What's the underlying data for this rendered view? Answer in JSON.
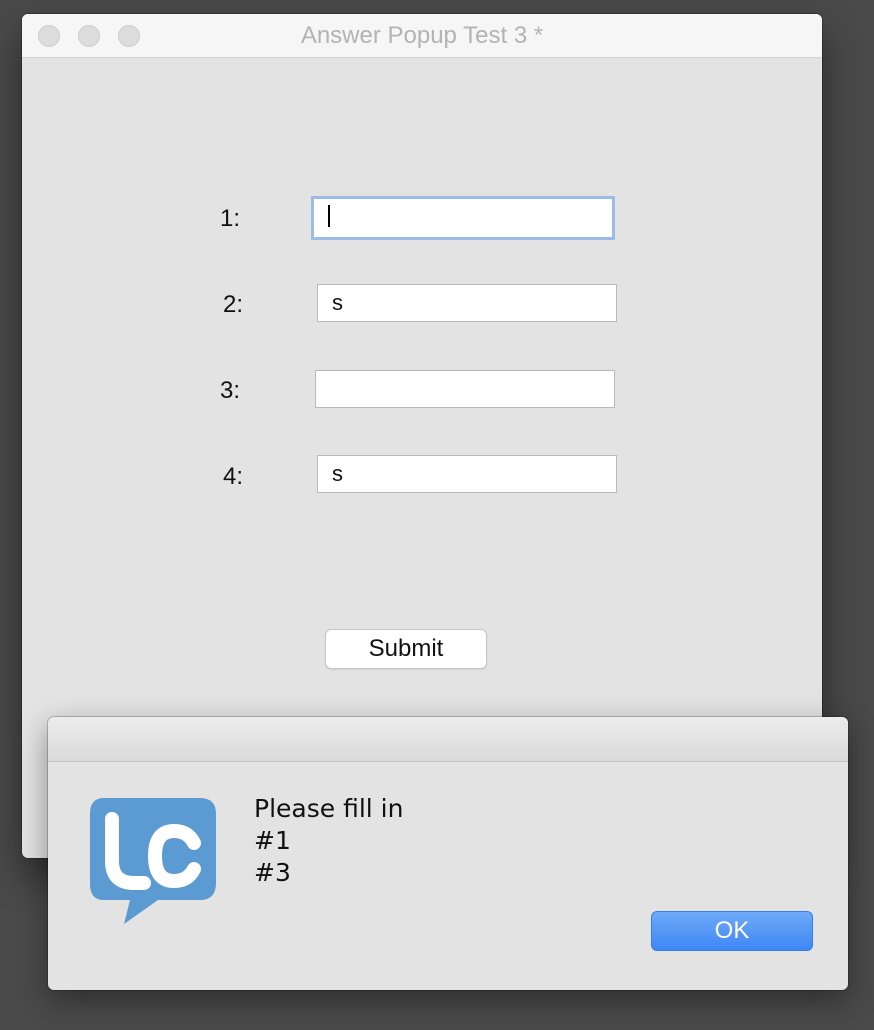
{
  "window": {
    "title": "Answer Popup Test 3 *"
  },
  "form": {
    "fields": [
      {
        "label": "1:",
        "value": "",
        "focused": true
      },
      {
        "label": "2:",
        "value": "s",
        "focused": false
      },
      {
        "label": "3:",
        "value": "",
        "focused": false
      },
      {
        "label": "4:",
        "value": "s",
        "focused": false
      }
    ],
    "submit_label": "Submit"
  },
  "dialog": {
    "icon": "livecode-logo-icon",
    "icon_text": "lc",
    "icon_color": "#5b9bd1",
    "message_lines": [
      "Please fill in",
      "#1",
      "#3"
    ],
    "ok_label": "OK",
    "ok_color": "#3f87f5"
  }
}
